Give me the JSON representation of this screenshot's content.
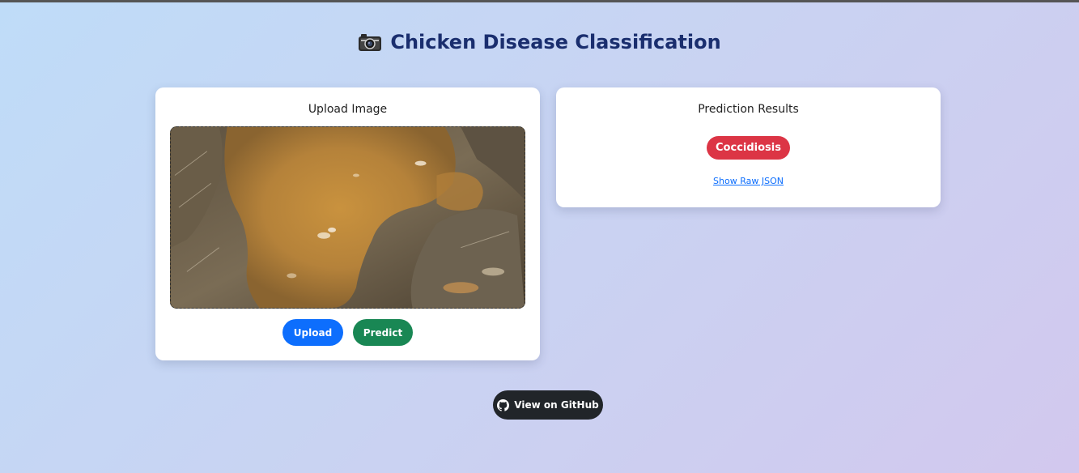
{
  "header": {
    "title": "Chicken Disease Classification",
    "icon": "camera-icon"
  },
  "upload_card": {
    "title": "Upload Image",
    "upload_label": "Upload",
    "predict_label": "Predict"
  },
  "results_card": {
    "title": "Prediction Results",
    "prediction": "Coccidiosis",
    "raw_json_link": "Show Raw JSON"
  },
  "footer": {
    "github_label": "View on GitHub",
    "icon": "github-icon"
  },
  "colors": {
    "title": "#1a2e6e",
    "upload_button": "#0d6efd",
    "predict_button": "#198754",
    "prediction_badge": "#dc3545",
    "github_button": "#212529"
  }
}
